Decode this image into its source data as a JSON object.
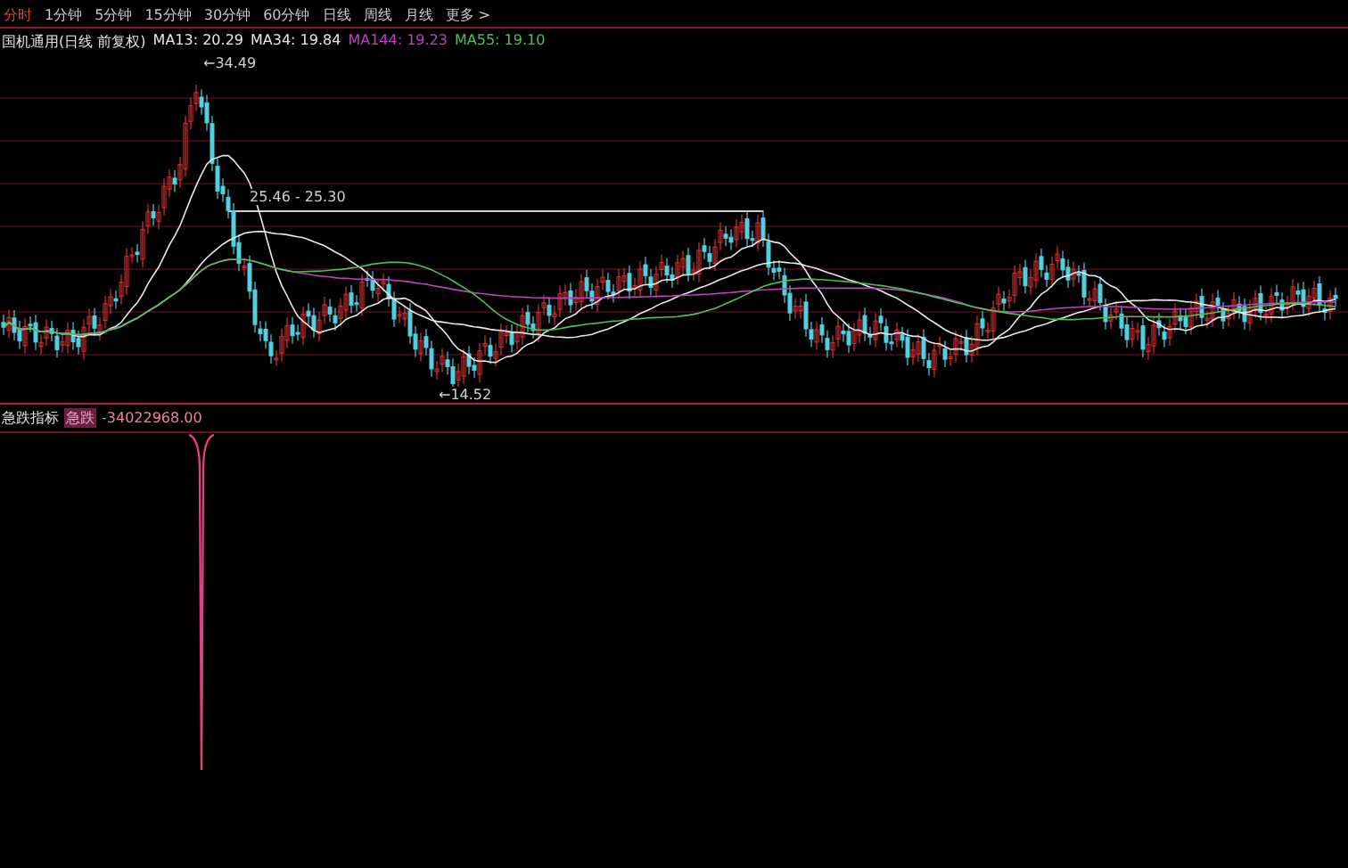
{
  "periods": [
    {
      "label": "分时",
      "selected": true
    },
    {
      "label": "1分钟",
      "selected": false
    },
    {
      "label": "5分钟",
      "selected": false
    },
    {
      "label": "15分钟",
      "selected": false
    },
    {
      "label": "30分钟",
      "selected": false
    },
    {
      "label": "60分钟",
      "selected": false
    },
    {
      "label": "日线",
      "selected": false
    },
    {
      "label": "周线",
      "selected": false
    },
    {
      "label": "月线",
      "selected": false
    },
    {
      "label": "更多 >",
      "selected": false
    }
  ],
  "main_legend": {
    "title": "国机通用(日线 前复权)",
    "averages": [
      {
        "label": "MA13: 20.29",
        "color": "#e8e8e8"
      },
      {
        "label": "MA34: 19.84",
        "color": "#e8e8e8"
      },
      {
        "label": "MA144: 19.23",
        "color": "#c040c0"
      },
      {
        "label": "MA55: 19.10",
        "color": "#50c050"
      }
    ]
  },
  "price_labels": {
    "high": "←34.49",
    "range": "25.46 - 25.30",
    "low": "←14.52"
  },
  "indicator": {
    "title": "急跌指标",
    "series_name": "急跌",
    "reading": "-34022968.00"
  }
}
